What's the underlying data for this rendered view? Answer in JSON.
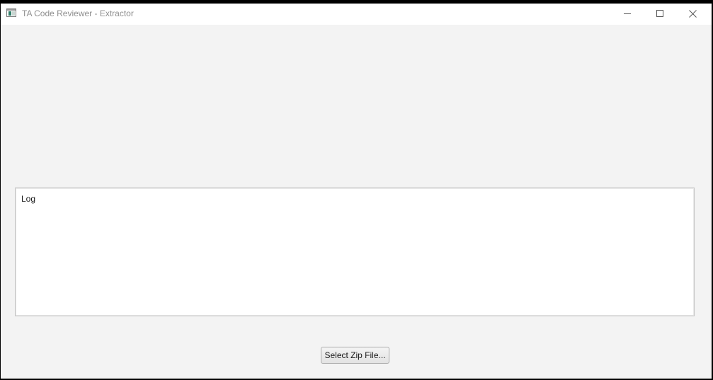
{
  "window": {
    "title": "TA Code Reviewer - Extractor"
  },
  "icons": {
    "app": "app-window-icon",
    "minimize": "minimize-icon",
    "maximize": "maximize-icon",
    "close": "close-icon"
  },
  "log": {
    "label": "Log"
  },
  "actions": {
    "select_zip_label": "Select Zip File..."
  },
  "colors": {
    "titlebar_bg": "#ffffff",
    "window_bg": "#f3f3f3",
    "title_text": "#8e8e8e"
  }
}
